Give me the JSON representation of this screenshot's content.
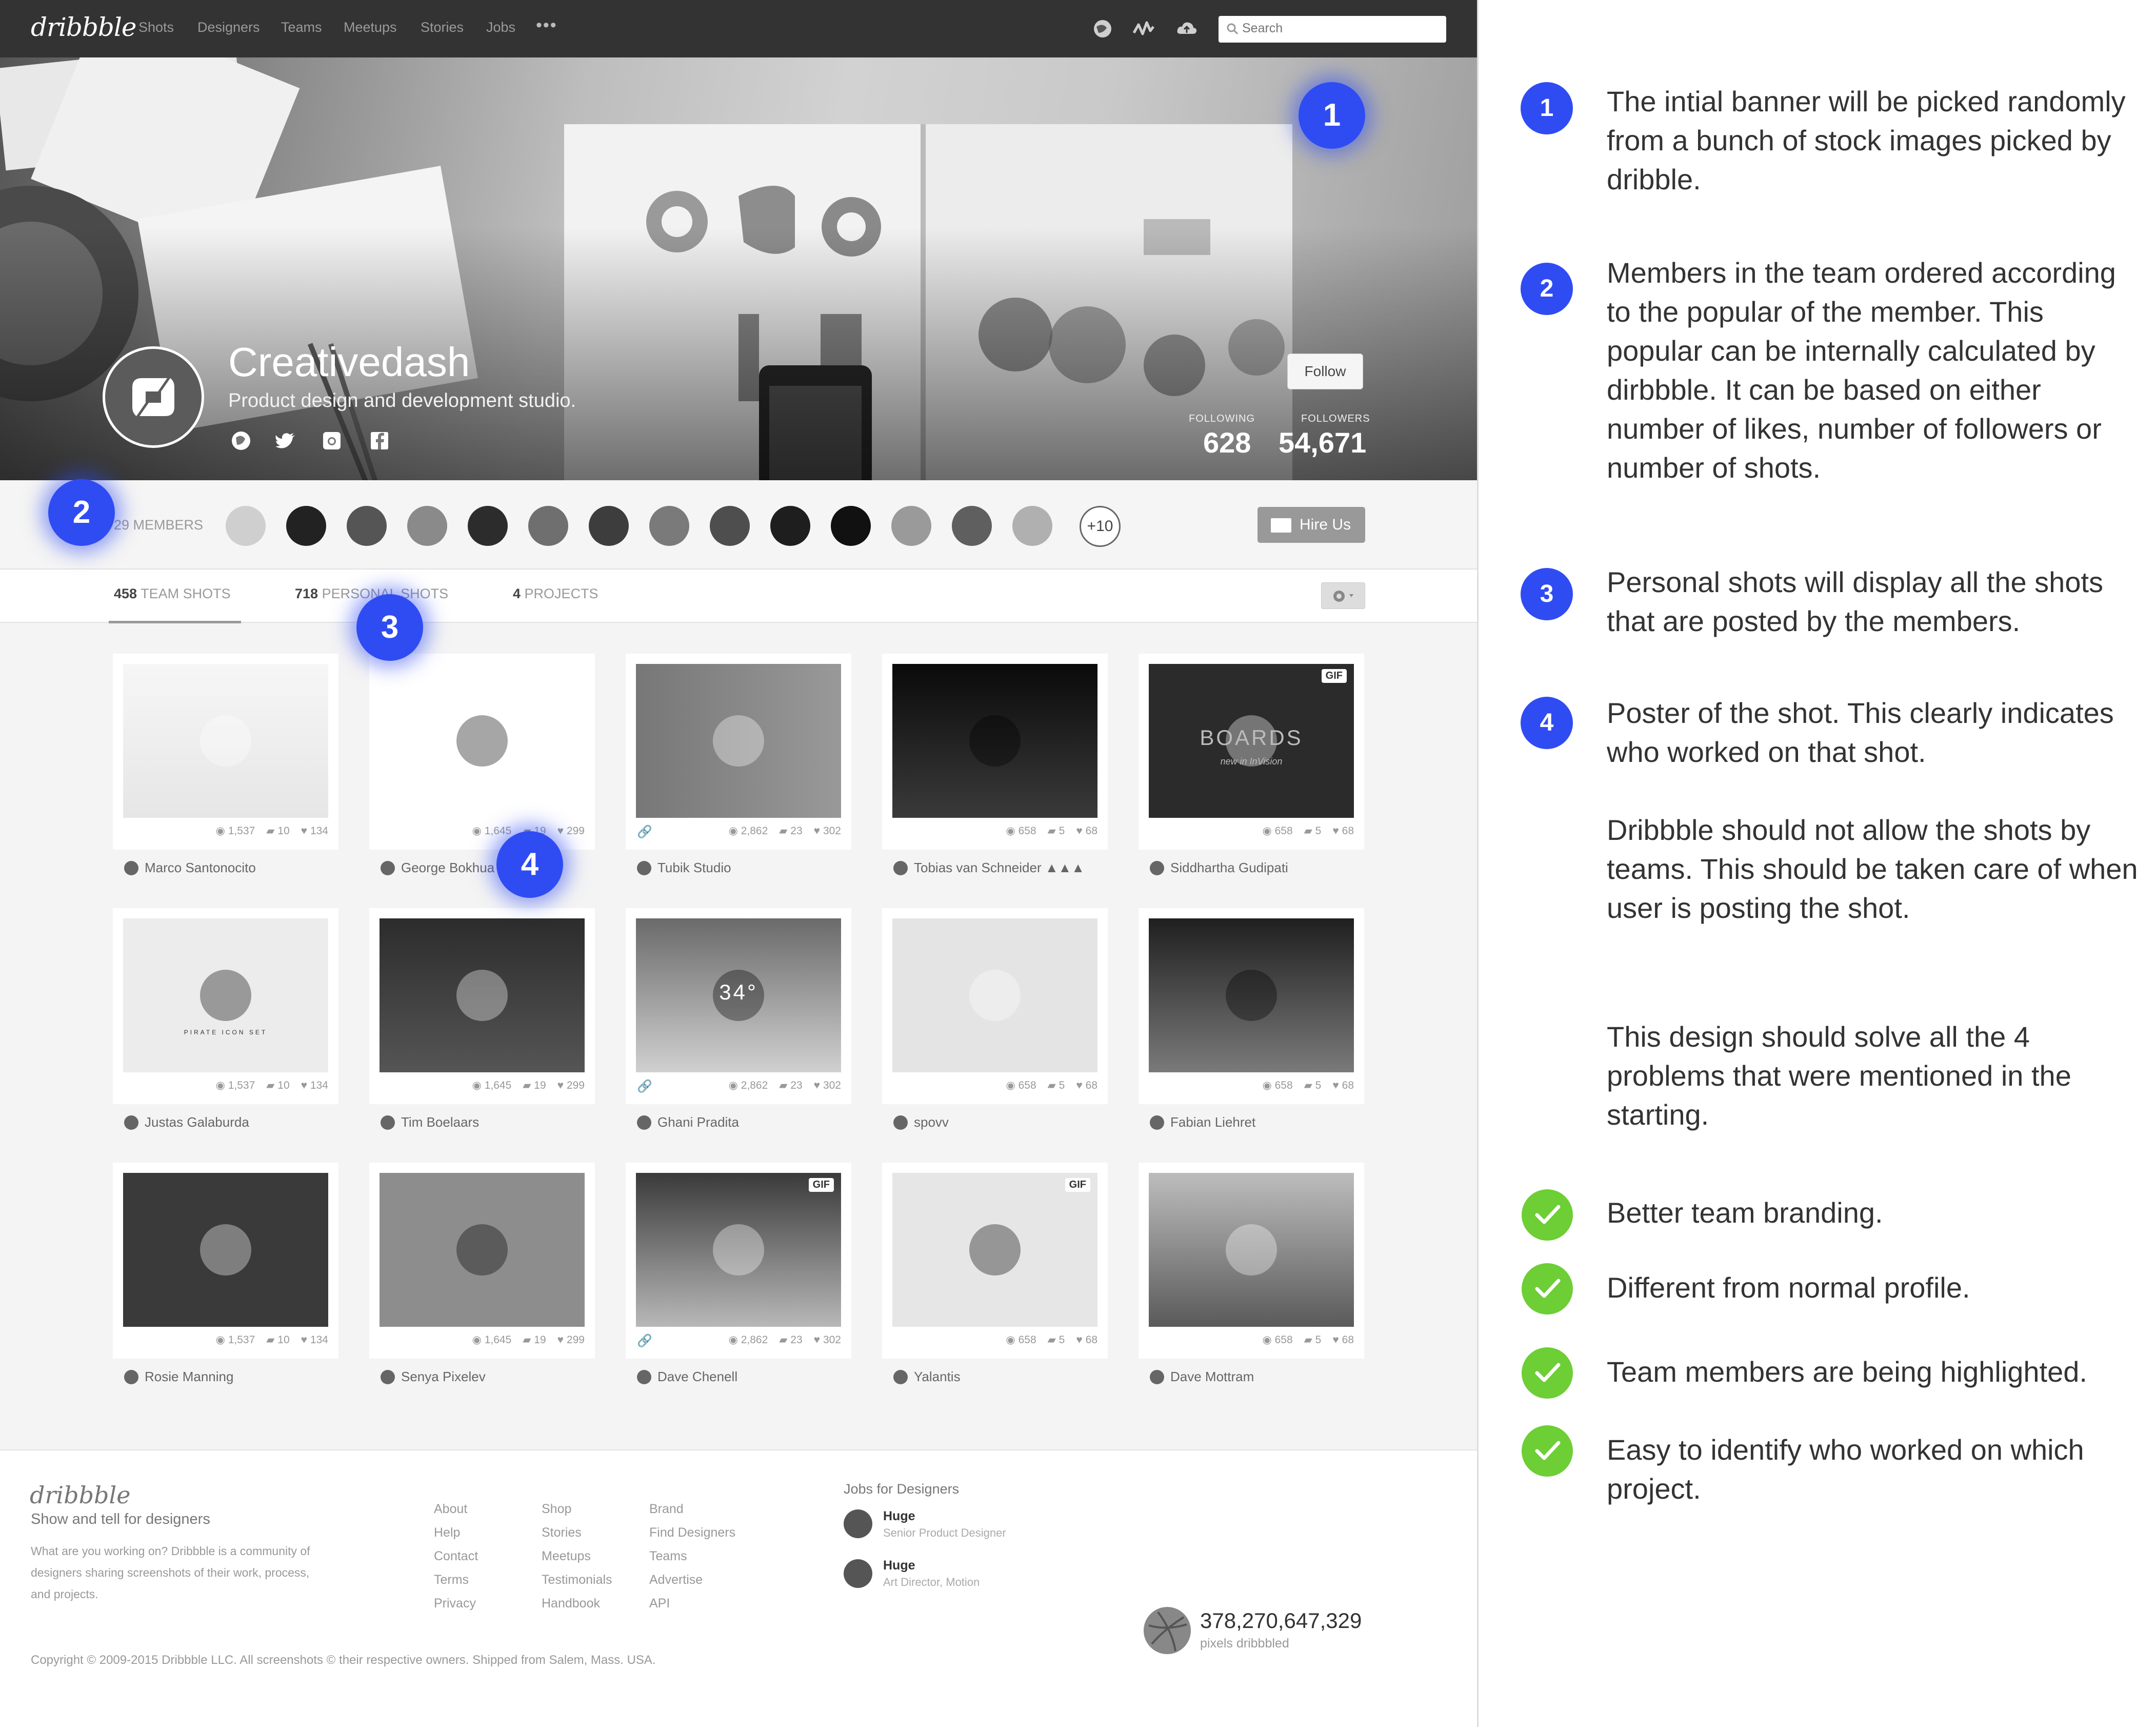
{
  "nav": {
    "logo": "dribbble",
    "links": [
      "Shots",
      "Designers",
      "Teams",
      "Meetups",
      "Stories",
      "Jobs"
    ],
    "more": "•••",
    "search_placeholder": "Search"
  },
  "banner": {
    "team_name": "Creativedash",
    "tagline": "Product design and development studio.",
    "follow_label": "Follow",
    "following_label": "FOLLOWING",
    "following_value": "628",
    "followers_label": "FOLLOWERS",
    "followers_value": "54,671"
  },
  "members": {
    "label": "29 MEMBERS",
    "more": "+10",
    "hire_label": "Hire Us"
  },
  "tabs": [
    {
      "count": "458",
      "label": "TEAM SHOTS"
    },
    {
      "count": "718",
      "label": "PERSONAL SHOTS"
    },
    {
      "count": "4",
      "label": "PROJECTS"
    }
  ],
  "shots": [
    {
      "poster": "Marco Santonocito",
      "views": "1,537",
      "comments": "10",
      "likes": "134"
    },
    {
      "poster": "George Bokhua",
      "views": "1,645",
      "comments": "19",
      "likes": "299"
    },
    {
      "poster": "Tubik Studio",
      "views": "2,862",
      "comments": "23",
      "likes": "302"
    },
    {
      "poster": "Tobias van Schneider ▲▲▲",
      "views": "658",
      "comments": "5",
      "likes": "68"
    },
    {
      "poster": "Siddhartha Gudipati",
      "views": "658",
      "comments": "5",
      "likes": "68",
      "gif": "GIF",
      "thumb_title": "BOARDS",
      "thumb_sub": "new in InVision"
    },
    {
      "poster": "Justas Galaburda",
      "views": "1,537",
      "comments": "10",
      "likes": "134",
      "thumb_title": "PIRATE ICON SET"
    },
    {
      "poster": "Tim Boelaars",
      "views": "1,645",
      "comments": "19",
      "likes": "299"
    },
    {
      "poster": "Ghani Pradita",
      "views": "2,862",
      "comments": "23",
      "likes": "302",
      "thumb_title": "34°"
    },
    {
      "poster": "spovv",
      "views": "658",
      "comments": "5",
      "likes": "68"
    },
    {
      "poster": "Fabian Liehret",
      "views": "658",
      "comments": "5",
      "likes": "68"
    },
    {
      "poster": "Rosie Manning",
      "views": "1,537",
      "comments": "10",
      "likes": "134"
    },
    {
      "poster": "Senya Pixelev",
      "views": "1,645",
      "comments": "19",
      "likes": "299"
    },
    {
      "poster": "Dave Chenell",
      "views": "2,862",
      "comments": "23",
      "likes": "302",
      "gif": "GIF"
    },
    {
      "poster": "Yalantis",
      "views": "658",
      "comments": "5",
      "likes": "68",
      "gif": "GIF"
    },
    {
      "poster": "Dave Mottram",
      "views": "658",
      "comments": "5",
      "likes": "68"
    }
  ],
  "footer": {
    "logo": "dribbble",
    "tagline": "Show and tell for designers",
    "description": "What are you working on? Dribbble is a community of designers sharing screenshots of their work, process, and projects.",
    "col1": [
      "About",
      "Help",
      "Contact",
      "Terms",
      "Privacy"
    ],
    "col2": [
      "Shop",
      "Stories",
      "Meetups",
      "Testimonials",
      "Handbook"
    ],
    "col3": [
      "Brand",
      "Find Designers",
      "Teams",
      "Advertise",
      "API"
    ],
    "jobs_title": "Jobs for Designers",
    "jobs": [
      {
        "company": "Huge",
        "role": "Senior Product Designer"
      },
      {
        "company": "Huge",
        "role": "Art Director, Motion"
      }
    ],
    "pixels_value": "378,270,647,329",
    "pixels_label": "pixels dribbbled",
    "copyright": "Copyright © 2009-2015 Dribbble LLC. All screenshots © their respective owners. Shipped from Salem, Mass. USA."
  },
  "markers": [
    "1",
    "2",
    "3",
    "4"
  ],
  "notes": {
    "items": [
      {
        "num": "1",
        "text": "The intial banner will be picked randomly from a bunch of stock images picked by dribble."
      },
      {
        "num": "2",
        "text": "Members in the team ordered according to the popular of the member. This popular can be internally calculated by dirbbble. It can be based on either number of likes, number of followers or number of shots."
      },
      {
        "num": "3",
        "text": "Personal shots will display all the shots that are posted by the members."
      },
      {
        "num": "4",
        "text": "Poster of the shot. This clearly indicates who worked on that shot."
      }
    ],
    "extra_1": "Dribbble should not allow the shots by teams. This should be taken care of when user is posting the shot.",
    "extra_2": "This design should solve all the 4 problems that were mentioned in the starting.",
    "checks": [
      "Better team branding.",
      "Different from normal profile.",
      "Team members are being highlighted.",
      "Easy to identify who worked on which project."
    ]
  },
  "colors": {
    "marker_blue": "#2f4cf3",
    "check_green": "#6dce35",
    "nav_dark": "#333333"
  }
}
